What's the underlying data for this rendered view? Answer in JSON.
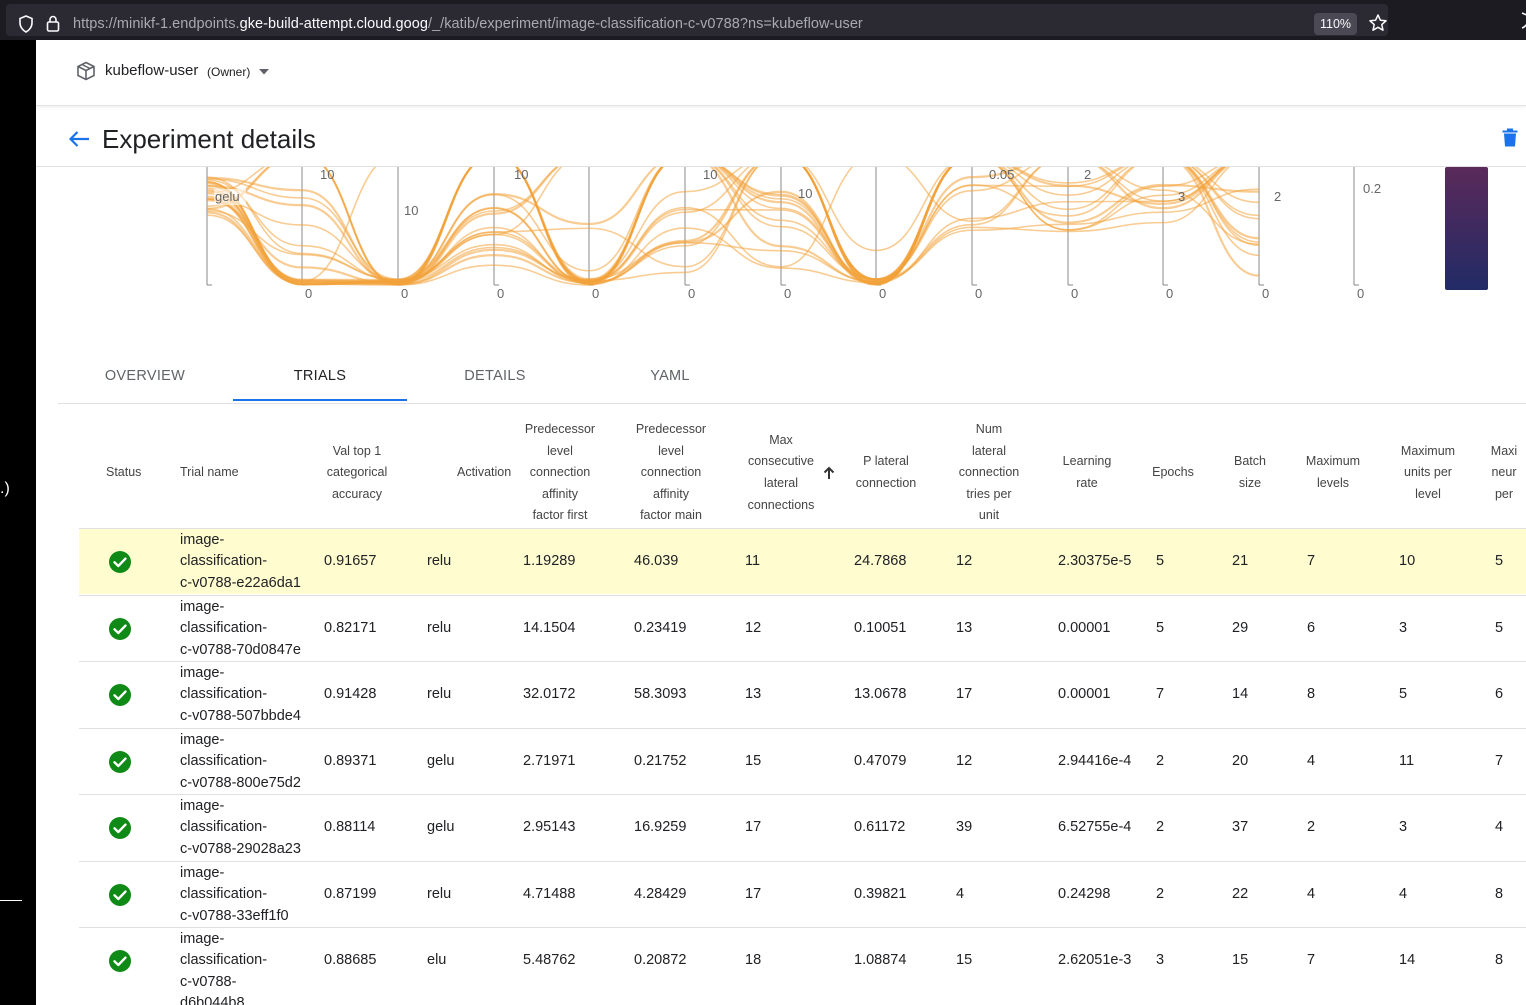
{
  "browser": {
    "url_prefix": "https://minikf-1.endpoints.",
    "url_domain": "gke-build-attempt.cloud.goog",
    "url_path": "/_/katib/experiment/image-classification-c-v0788?ns=kubeflow-user",
    "zoom": "110%"
  },
  "left_strip_text": ".)",
  "namespace": {
    "name": "kubeflow-user",
    "role": "(Owner)"
  },
  "page": {
    "title": "Experiment details"
  },
  "chart_labels": {
    "category_label": "gelu",
    "ticks": [
      "10",
      "10",
      "10",
      "10",
      "10",
      "10",
      "0.05",
      "2",
      "3",
      "2",
      "0.2",
      "0",
      "0",
      "0",
      "0",
      "0",
      "0",
      "0",
      "0",
      "0",
      "0",
      "0",
      "0",
      "0"
    ]
  },
  "tabs": [
    "OVERVIEW",
    "TRIALS",
    "DETAILS",
    "YAML"
  ],
  "active_tab": "TRIALS",
  "table": {
    "headers": [
      "Status",
      "Trial name",
      "Val top 1 categorical accuracy",
      "Activation",
      "Predecessor level connection affinity factor first",
      "Predecessor level connection affinity factor main",
      "Max consecutive lateral connections",
      "P lateral connection",
      "Num lateral connection tries per unit",
      "Learning rate",
      "Epochs",
      "Batch size",
      "Maximum levels",
      "Maximum units per level",
      "Maxi neur per"
    ],
    "header_lines": [
      [
        "Status"
      ],
      [
        "Trial name"
      ],
      [
        "Val top 1",
        "categorical",
        "accuracy"
      ],
      [
        "Activation"
      ],
      [
        "Predecessor",
        "level",
        "connection",
        "affinity",
        "factor first"
      ],
      [
        "Predecessor",
        "level",
        "connection",
        "affinity",
        "factor main"
      ],
      [
        "Max",
        "consecutive",
        "lateral",
        "connections"
      ],
      [
        "P lateral",
        "connection"
      ],
      [
        "Num",
        "lateral",
        "connection",
        "tries per",
        "unit"
      ],
      [
        "Learning",
        "rate"
      ],
      [
        "Epochs"
      ],
      [
        "Batch",
        "size"
      ],
      [
        "Maximum",
        "levels"
      ],
      [
        "Maximum",
        "units per",
        "level"
      ],
      [
        "Maxi",
        "neur",
        "per"
      ]
    ],
    "sort_column": "Max consecutive lateral connections",
    "rows": [
      {
        "status": "succeeded",
        "name": [
          "image-",
          "classification-",
          "c-v0788-e22a6da1"
        ],
        "values": [
          "0.91657",
          "relu",
          "1.19289",
          "46.039",
          "11",
          "24.7868",
          "12",
          "2.30375e-5",
          "5",
          "21",
          "7",
          "10",
          "5"
        ],
        "highlighted": true
      },
      {
        "status": "succeeded",
        "name": [
          "image-",
          "classification-",
          "c-v0788-70d0847e"
        ],
        "values": [
          "0.82171",
          "relu",
          "14.1504",
          "0.23419",
          "12",
          "0.10051",
          "13",
          "0.00001",
          "5",
          "29",
          "6",
          "3",
          "5"
        ]
      },
      {
        "status": "succeeded",
        "name": [
          "image-",
          "classification-",
          "c-v0788-507bbde4"
        ],
        "values": [
          "0.91428",
          "relu",
          "32.0172",
          "58.3093",
          "13",
          "13.0678",
          "17",
          "0.00001",
          "7",
          "14",
          "8",
          "5",
          "6"
        ]
      },
      {
        "status": "succeeded",
        "name": [
          "image-",
          "classification-",
          "c-v0788-800e75d2"
        ],
        "values": [
          "0.89371",
          "gelu",
          "2.71971",
          "0.21752",
          "15",
          "0.47079",
          "12",
          "2.94416e-4",
          "2",
          "20",
          "4",
          "11",
          "7"
        ]
      },
      {
        "status": "succeeded",
        "name": [
          "image-",
          "classification-",
          "c-v0788-29028a23"
        ],
        "values": [
          "0.88114",
          "gelu",
          "2.95143",
          "16.9259",
          "17",
          "0.61172",
          "39",
          "6.52755e-4",
          "2",
          "37",
          "2",
          "3",
          "4"
        ]
      },
      {
        "status": "succeeded",
        "name": [
          "image-",
          "classification-",
          "c-v0788-33eff1f0"
        ],
        "values": [
          "0.87199",
          "relu",
          "4.71488",
          "4.28429",
          "17",
          "0.39821",
          "4",
          "0.24298",
          "2",
          "22",
          "4",
          "4",
          "8"
        ]
      },
      {
        "status": "succeeded",
        "name": [
          "image-",
          "classification-",
          "c-v0788-",
          "d6b044b8"
        ],
        "values": [
          "0.88685",
          "elu",
          "5.48762",
          "0.20872",
          "18",
          "1.08874",
          "15",
          "2.62051e-3",
          "3",
          "15",
          "7",
          "14",
          "8"
        ]
      }
    ]
  },
  "colors": {
    "accent": "#1a73e8",
    "success": "#0f8a16",
    "highlight": "#fffdd0",
    "curve": "#f2a33a",
    "gradient_top": "#5a2a5a",
    "gradient_bottom": "#222b66"
  }
}
